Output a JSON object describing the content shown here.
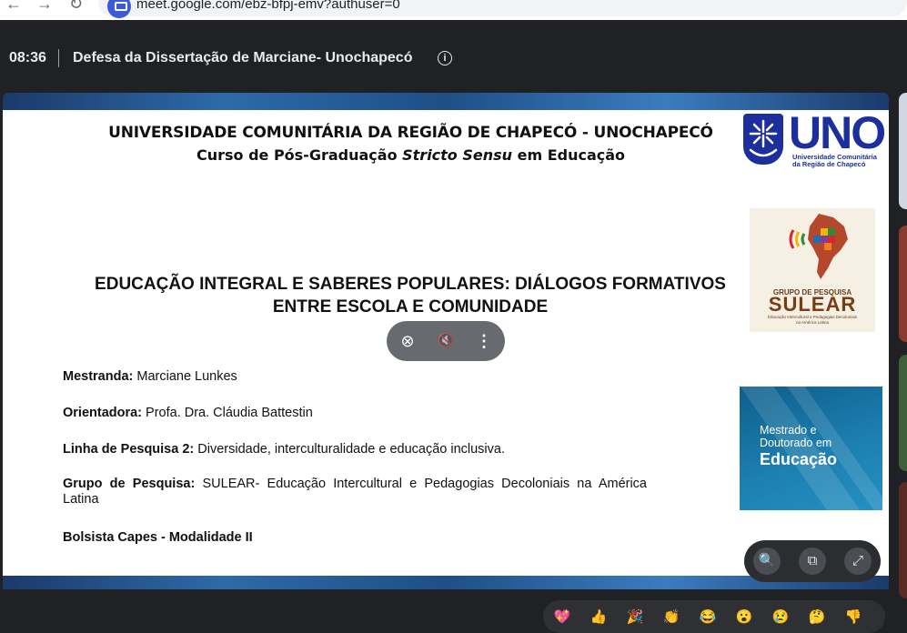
{
  "browser": {
    "back_glyph": "←",
    "forward_glyph": "→",
    "reload_glyph": "↻",
    "url": "meet.google.com/ebz-bfpj-emv?authuser=0"
  },
  "meeting": {
    "time": "08:36",
    "title": "Defesa da Dissertação de Marciane- Unochapecó",
    "info_glyph": "i"
  },
  "slide": {
    "university": "UNIVERSIDADE COMUNITÁRIA DA REGIÃO DE CHAPECÓ - UNOCHAPECÓ",
    "course_prefix": "Curso de Pós-Graduação ",
    "course_italic": "Stricto Sensu",
    "course_suffix": " em Educação",
    "thesis_title": "EDUCAÇÃO INTEGRAL E SABERES POPULARES: DIÁLOGOS FORMATIVOS ENTRE ESCOLA E COMUNIDADE",
    "mestranda_label": "Mestranda:",
    "mestranda_value": " Marciane Lunkes",
    "orientadora_label": "Orientadora:",
    "orientadora_value": " Profa. Dra. Cláudia Battestin",
    "linha_label": "Linha de Pesquisa 2:",
    "linha_value": " Diversidade, interculturalidade e educação inclusiva.",
    "grupo_label": "Grupo de Pesquisa:",
    "grupo_value": " SULEAR- Educação Intercultural e Pedagogias Decoloniais na América Latina",
    "bolsista": "Bolsista Capes - Modalidade II"
  },
  "logos": {
    "uno_text": "UNO",
    "uno_sub1": "Universidade Comunitária",
    "uno_sub2": "da Região de Chapecó",
    "sulear_group": "GRUPO DE PESQUISA",
    "sulear_name": "SULEAR",
    "sulear_sub": "Educação Intercultural e Pedagogias Decoloniais na América Latina",
    "ppge_l1": "Mestrado e",
    "ppge_l2": "Doutorado em",
    "ppge_l3": "Educação"
  },
  "pill": {
    "unpin_glyph": "⊗",
    "mute_glyph": "🔇",
    "more_glyph": "⋮"
  },
  "zoom": {
    "zoom_glyph": "🔍",
    "popout_glyph": "⧉",
    "fullscreen_glyph": "⤢"
  },
  "reactions": [
    "💖",
    "👍",
    "🎉",
    "👏",
    "😂",
    "😮",
    "😢",
    "🤔",
    "👎"
  ],
  "colors": {
    "meet_bg": "#202124",
    "uno_blue": "#1d2f9c",
    "sulear_brown": "#7a3d12",
    "ppge_blue": "#1c7fb0"
  }
}
